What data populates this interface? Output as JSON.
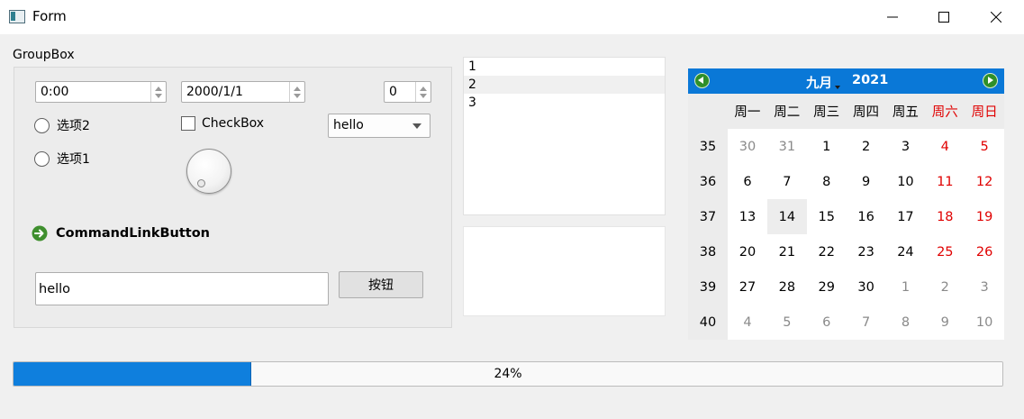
{
  "window": {
    "title": "Form",
    "controls": [
      "minimize",
      "maximize",
      "close"
    ]
  },
  "groupbox": {
    "title": "GroupBox",
    "time_edit": "0:00",
    "date_edit": "2000/1/1",
    "spinbox": "0",
    "radio_2": "选项2",
    "radio_1": "选项1",
    "checkbox": "CheckBox",
    "combobox": "hello",
    "dial_value": 0,
    "command_link": "CommandLinkButton",
    "line_edit": "hello",
    "push_button": "按钮"
  },
  "list_widget": {
    "items": [
      "1",
      "2",
      "3"
    ]
  },
  "text_edit": {
    "value": ""
  },
  "calendar": {
    "month": "九月",
    "year": "2021",
    "weekdays": [
      "周一",
      "周二",
      "周三",
      "周四",
      "周五",
      "周六",
      "周日"
    ],
    "weeks": [
      {
        "week": "35",
        "days": [
          "30",
          "31",
          "1",
          "2",
          "3",
          "4",
          "5"
        ]
      },
      {
        "week": "36",
        "days": [
          "6",
          "7",
          "8",
          "9",
          "10",
          "11",
          "12"
        ]
      },
      {
        "week": "37",
        "days": [
          "13",
          "14",
          "15",
          "16",
          "17",
          "18",
          "19"
        ]
      },
      {
        "week": "38",
        "days": [
          "20",
          "21",
          "22",
          "23",
          "24",
          "25",
          "26"
        ]
      },
      {
        "week": "39",
        "days": [
          "27",
          "28",
          "29",
          "30",
          "1",
          "2",
          "3"
        ]
      },
      {
        "week": "40",
        "days": [
          "4",
          "5",
          "6",
          "7",
          "8",
          "9",
          "10"
        ]
      }
    ],
    "selected_day": "14",
    "colors": {
      "header": "#0a78d7",
      "weekend": "#e00000",
      "other_month": "#8a8a8a"
    }
  },
  "progress": {
    "value": 24,
    "label": "24%",
    "color": "#0f7fdd"
  }
}
